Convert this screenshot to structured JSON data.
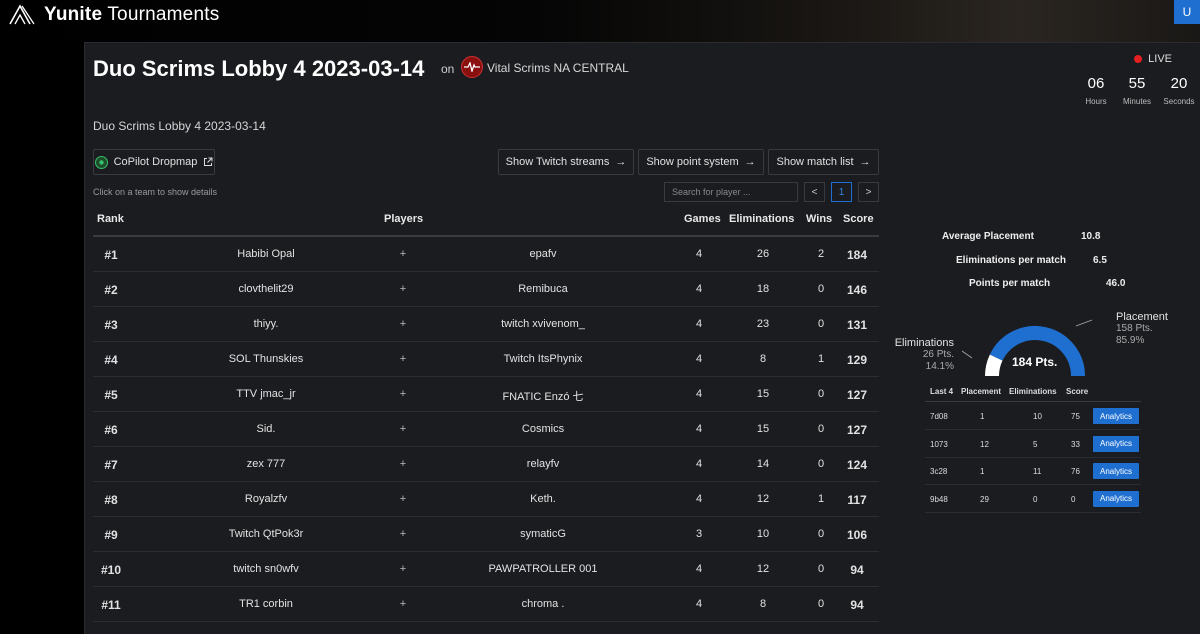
{
  "app": {
    "brand_bold": "Yunite",
    "brand_rest": "Tournaments",
    "corner_button": "U"
  },
  "header": {
    "title": "Duo Scrims Lobby 4 2023-03-14",
    "on_label": "on",
    "org_name": "Vital Scrims NA CENTRAL",
    "live_label": "LIVE",
    "countdown": [
      {
        "value": "06",
        "unit": "Hours"
      },
      {
        "value": "55",
        "unit": "Minutes"
      },
      {
        "value": "20",
        "unit": "Seconds"
      }
    ],
    "subtitle": "Duo Scrims Lobby 4 2023-03-14"
  },
  "toolbar": {
    "copilot_label": "CoPilot Dropmap",
    "twitch_label": "Show Twitch streams",
    "points_label": "Show point system",
    "matches_label": "Show match list",
    "hint": "Click on a team to show details",
    "search_placeholder": "Search for player ...",
    "page_prev": "<",
    "page_current": "1",
    "page_next": ">"
  },
  "table": {
    "headers": {
      "rank": "Rank",
      "players": "Players",
      "games": "Games",
      "eliminations": "Eliminations",
      "wins": "Wins",
      "score": "Score"
    },
    "rows": [
      {
        "rank": "#1",
        "player1": "Habibi Opal",
        "plus": "+",
        "player2": "epafv",
        "games": "4",
        "elims": "26",
        "wins": "2",
        "score": "184"
      },
      {
        "rank": "#2",
        "player1": "clovthelit29",
        "plus": "+",
        "player2": "Remibuca",
        "games": "4",
        "elims": "18",
        "wins": "0",
        "score": "146"
      },
      {
        "rank": "#3",
        "player1": "thiyy.",
        "plus": "+",
        "player2": "twitch xvivenom_",
        "games": "4",
        "elims": "23",
        "wins": "0",
        "score": "131"
      },
      {
        "rank": "#4",
        "player1": "SOL Thunskies",
        "plus": "+",
        "player2": "Twitch ItsPhynix",
        "games": "4",
        "elims": "8",
        "wins": "1",
        "score": "129"
      },
      {
        "rank": "#5",
        "player1": "TTV jmac_jr",
        "plus": "+",
        "player2": "FNATIC Enzó 七",
        "games": "4",
        "elims": "15",
        "wins": "0",
        "score": "127"
      },
      {
        "rank": "#6",
        "player1": "Sid.",
        "plus": "+",
        "player2": "Cosmics",
        "games": "4",
        "elims": "15",
        "wins": "0",
        "score": "127"
      },
      {
        "rank": "#7",
        "player1": "zex 777",
        "plus": "+",
        "player2": "relayfv",
        "games": "4",
        "elims": "14",
        "wins": "0",
        "score": "124"
      },
      {
        "rank": "#8",
        "player1": "Royalzfv",
        "plus": "+",
        "player2": "Keth.",
        "games": "4",
        "elims": "12",
        "wins": "1",
        "score": "117"
      },
      {
        "rank": "#9",
        "player1": "Twitch QtPok3r",
        "plus": "+",
        "player2": "symaticG",
        "games": "3",
        "elims": "10",
        "wins": "0",
        "score": "106"
      },
      {
        "rank": "#10",
        "player1": "twitch sn0wfv",
        "plus": "+",
        "player2": "PAWPATROLLER 001",
        "games": "4",
        "elims": "12",
        "wins": "0",
        "score": "94"
      },
      {
        "rank": "#11",
        "player1": "TR1 corbin",
        "plus": "+",
        "player2": "chroma .",
        "games": "4",
        "elims": "8",
        "wins": "0",
        "score": "94"
      }
    ]
  },
  "details": {
    "stats": [
      {
        "label": "Average Placement",
        "value": "10.8"
      },
      {
        "label": "Eliminations per match",
        "value": "6.5"
      },
      {
        "label": "Points per match",
        "value": "46.0"
      }
    ],
    "gauge": {
      "center_label": "184 Pts.",
      "elim_fraction": 0.141,
      "eliminations": {
        "label": "Eliminations",
        "points": "26 Pts.",
        "percent": "14.1%"
      },
      "placement": {
        "label": "Placement",
        "points": "158 Pts.",
        "percent": "85.9%"
      },
      "colors": {
        "placement": "#1f6fd1",
        "eliminations": "#ffffff"
      }
    },
    "last4": {
      "headers": {
        "match": "Last 4",
        "placement": "Placement",
        "eliminations": "Eliminations",
        "score": "Score"
      },
      "rows": [
        {
          "match": "7d08",
          "placement": "1",
          "elims": "10",
          "score": "75",
          "action": "Analytics"
        },
        {
          "match": "1073",
          "placement": "12",
          "elims": "5",
          "score": "33",
          "action": "Analytics"
        },
        {
          "match": "3c28",
          "placement": "1",
          "elims": "11",
          "score": "76",
          "action": "Analytics"
        },
        {
          "match": "9b48",
          "placement": "29",
          "elims": "0",
          "score": "0",
          "action": "Analytics"
        }
      ]
    }
  }
}
